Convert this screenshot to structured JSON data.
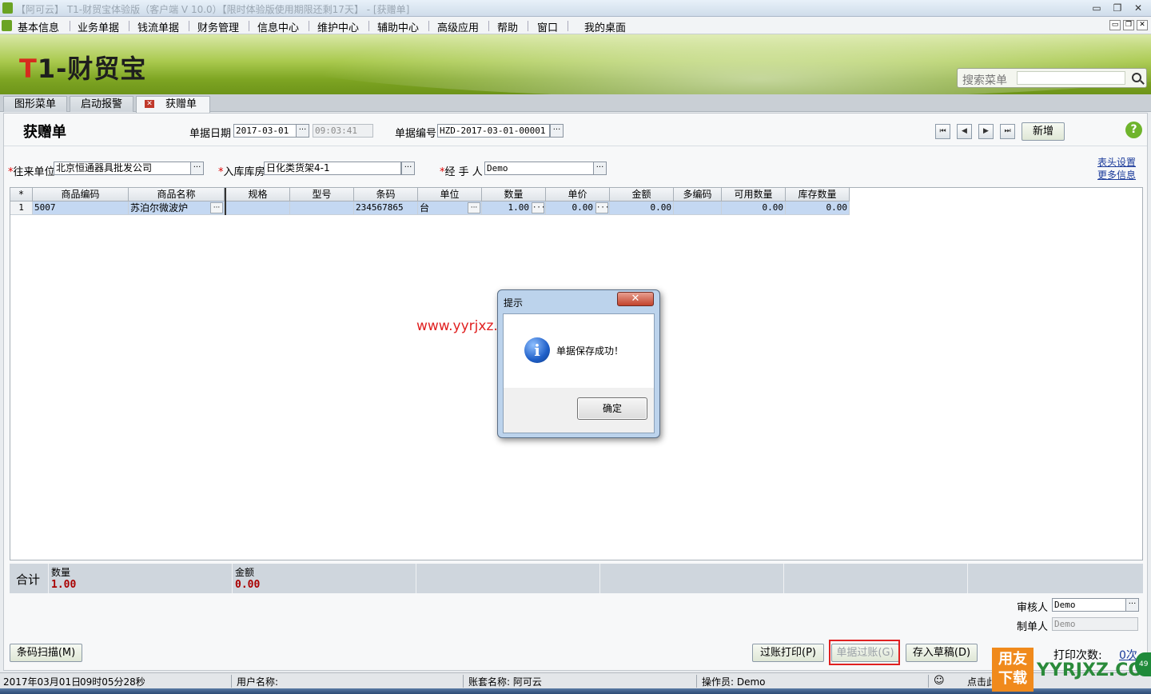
{
  "window": {
    "title": "【阿可云】 T1-财贸宝体验版（客户端 V 10.0）【限时体验版使用期限还剩17天】 - [获赠单]",
    "minimize": "▭",
    "restore": "❐",
    "close": "✕"
  },
  "menubar": {
    "items": [
      "基本信息",
      "业务单据",
      "钱流单据",
      "财务管理",
      "信息中心",
      "维护中心",
      "辅助中心",
      "高级应用",
      "帮助",
      "窗口",
      "我的桌面"
    ]
  },
  "banner": {
    "logo_t": "T",
    "logo_rest": "1-财贸宝",
    "search_placeholder": "搜索菜单"
  },
  "tabs": [
    {
      "label": "图形菜单"
    },
    {
      "label": "启动报警"
    },
    {
      "label": "获赠单",
      "close": "✕"
    }
  ],
  "form": {
    "title": "获赠单",
    "date_label": "单据日期",
    "date_value": "2017-03-01",
    "time_value": "09:03:41",
    "number_label": "单据编号",
    "number_value": "HZD-2017-03-01-00001",
    "new_button": "新增",
    "help": "?",
    "partner_label": "往来单位",
    "partner_value": "北京恒通器具批发公司",
    "warehouse_label": "入库库房",
    "warehouse_value": "日化类货架4-1",
    "handler_label": "经 手 人",
    "handler_value": "Demo",
    "header_settings": "表头设置",
    "more_info": "更多信息",
    "required_mark": "*",
    "dots": "···"
  },
  "nav": {
    "first": "⏮",
    "prev": "◀",
    "next": "▶",
    "last": "⏭"
  },
  "grid": {
    "corner": "*",
    "columns": [
      "商品编码",
      "商品名称",
      "规格",
      "型号",
      "条码",
      "单位",
      "数量",
      "单价",
      "金额",
      "多编码",
      "可用数量",
      "库存数量"
    ],
    "rows": [
      {
        "idx": "1",
        "code": "5007",
        "name": "苏泊尔微波炉",
        "spec": "",
        "model": "",
        "barcode": "234567865",
        "unit": "台",
        "qty": "1.00",
        "price": "0.00",
        "amount": "0.00",
        "multi": "",
        "avail": "0.00",
        "stock": "0.00"
      }
    ]
  },
  "totals": {
    "label": "合计",
    "qty_label": "数量",
    "qty_value": "1.00",
    "amount_label": "金额",
    "amount_value": "0.00"
  },
  "approval": {
    "auditor_label": "审核人",
    "auditor_value": "Demo",
    "maker_label": "制单人",
    "maker_value": "Demo"
  },
  "buttons": {
    "barcode_scan": "条码扫描(M)",
    "post_print": "过账打印(P)",
    "post": "单据过账(G)",
    "save_draft": "存入草稿(D)",
    "print_count_label": "打印次数:",
    "print_count_value": "0次"
  },
  "dialog": {
    "title": "提示",
    "close": "✕",
    "icon": "i",
    "message": "单据保存成功！",
    "ok": "确定"
  },
  "watermark": "www.yyrjxz.com",
  "statusbar": {
    "date": "2017年03月01日",
    "time": "09时05分28秒",
    "user_label": "用户名称:",
    "account_label": "账套名称: 阿可云",
    "operator_label": "操作员: Demo",
    "hint": "点击此"
  },
  "corner_brand": {
    "logo_line1": "用友",
    "logo_line2": "下载",
    "site": "YYRJXZ.COM",
    "badge": "49"
  }
}
